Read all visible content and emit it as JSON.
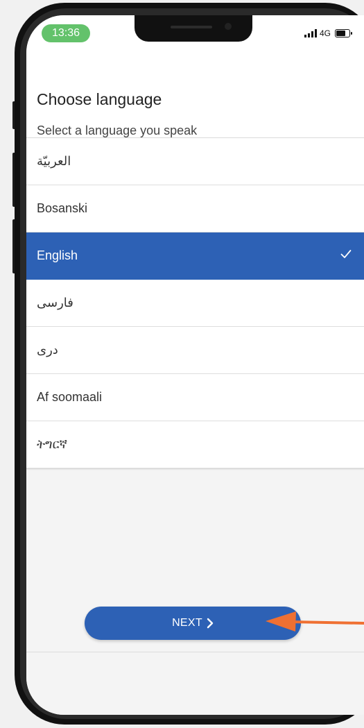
{
  "status_bar": {
    "time": "13:36",
    "network": "4G"
  },
  "header": {
    "title": "Choose language",
    "subtitle": "Select a language you speak"
  },
  "languages": [
    {
      "label": "العربيّة",
      "selected": false
    },
    {
      "label": "Bosanski",
      "selected": false
    },
    {
      "label": "English",
      "selected": true
    },
    {
      "label": "فارسی",
      "selected": false
    },
    {
      "label": "دری",
      "selected": false
    },
    {
      "label": "Af soomaali",
      "selected": false
    },
    {
      "label": "ትግርኛ",
      "selected": false
    }
  ],
  "next_button": {
    "label": "NEXT"
  },
  "colors": {
    "primary": "#2d61b5",
    "time_pill": "#63c26b",
    "annotation_arrow": "#ef7032"
  }
}
